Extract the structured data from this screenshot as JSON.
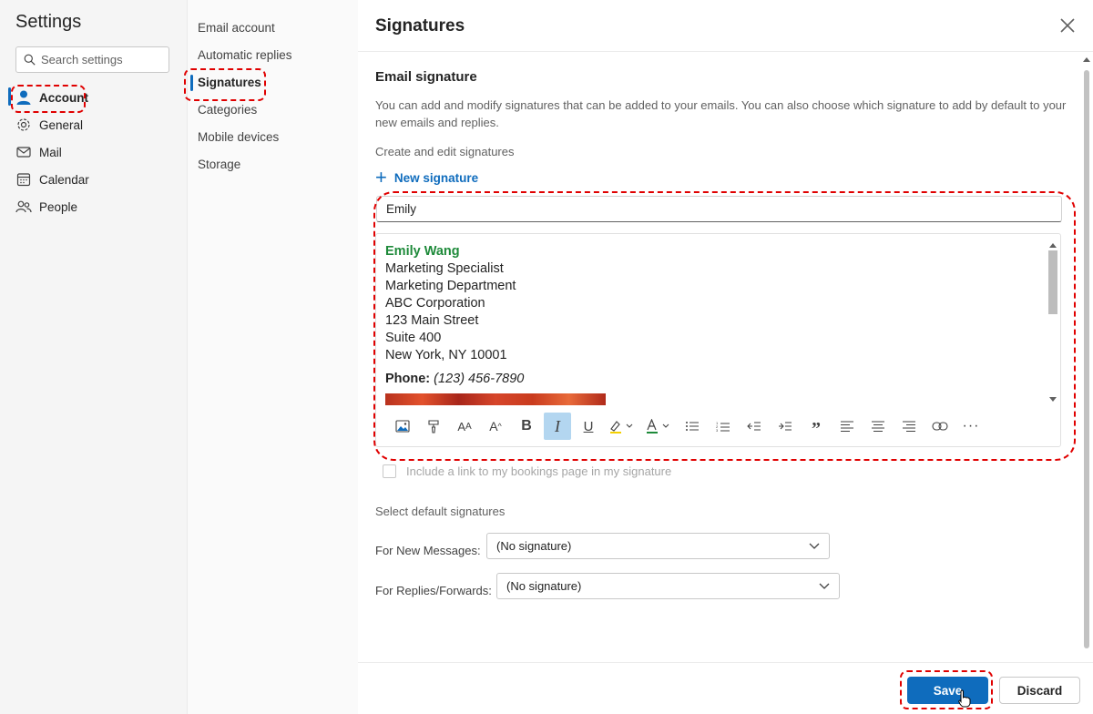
{
  "left_nav": {
    "title": "Settings",
    "search_placeholder": "Search settings",
    "items": [
      {
        "label": "Account",
        "icon": "person-icon"
      },
      {
        "label": "General",
        "icon": "gear-icon"
      },
      {
        "label": "Mail",
        "icon": "mail-icon"
      },
      {
        "label": "Calendar",
        "icon": "calendar-icon"
      },
      {
        "label": "People",
        "icon": "people-icon"
      }
    ],
    "active_index": 0
  },
  "mid_nav": {
    "items": [
      "Email account",
      "Automatic replies",
      "Signatures",
      "Categories",
      "Mobile devices",
      "Storage"
    ],
    "active_index": 2
  },
  "main": {
    "title": "Signatures",
    "section_title": "Email signature",
    "description": "You can add and modify signatures that can be added to your emails. You can also choose which signature to add by default to your new emails and replies.",
    "create_label": "Create and edit signatures",
    "new_signature_label": "New signature",
    "signature_name": "Emily",
    "signature": {
      "name": "Emily Wang",
      "lines": [
        "Marketing Specialist",
        "Marketing Department",
        "ABC Corporation",
        "123 Main Street",
        "Suite 400",
        "New York, NY 10001"
      ],
      "phone_label": "Phone:",
      "phone_value": "(123) 456-7890"
    },
    "toolbar_icons": [
      "insert-image-icon",
      "format-painter-icon",
      "font-size-icon",
      "increase-font-icon",
      "bold-icon",
      "italic-icon",
      "underline-icon",
      "highlight-icon",
      "font-color-icon",
      "bullets-icon",
      "numbering-icon",
      "decrease-indent-icon",
      "increase-indent-icon",
      "quote-icon",
      "align-left-icon",
      "align-center-icon",
      "align-right-icon",
      "link-icon",
      "more-options-icon"
    ],
    "bookings_label": "Include a link to my bookings page in my signature",
    "default_label": "Select default signatures",
    "new_messages_label": "For New Messages:",
    "new_messages_value": "(No signature)",
    "replies_label": "For Replies/Forwards:",
    "replies_value": "(No signature)"
  },
  "footer": {
    "save_label": "Save",
    "discard_label": "Discard"
  },
  "colors": {
    "accent": "#0f6cbd",
    "signature_name": "#1e8a3a",
    "highlight_marker": "#e00000"
  }
}
